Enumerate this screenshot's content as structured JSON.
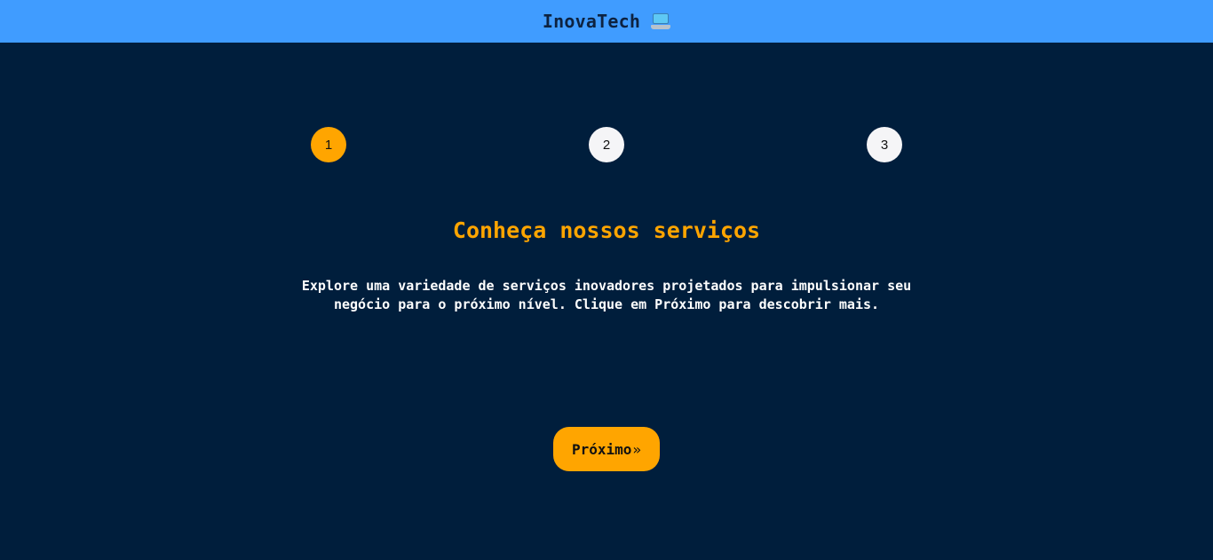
{
  "header": {
    "brand_text": "InovaTech",
    "brand_icon": "laptop-icon",
    "background_color": "#409cff"
  },
  "steps": {
    "current": 1,
    "items": [
      {
        "label": "1",
        "active": true
      },
      {
        "label": "2",
        "active": false
      },
      {
        "label": "3",
        "active": false
      }
    ],
    "active_color": "#ffa500",
    "inactive_color": "#f5f5f7"
  },
  "content": {
    "title": "Conheça nossos serviços",
    "description": "Explore uma variedade de serviços inovadores projetados para impulsionar seu negócio para o próximo nível. Clique em Próximo para descobrir mais."
  },
  "next_button": {
    "label": "Próximo",
    "arrow": "»"
  },
  "colors": {
    "page_background": "#001e3c",
    "accent": "#ffa500",
    "text": "#ffffff"
  }
}
